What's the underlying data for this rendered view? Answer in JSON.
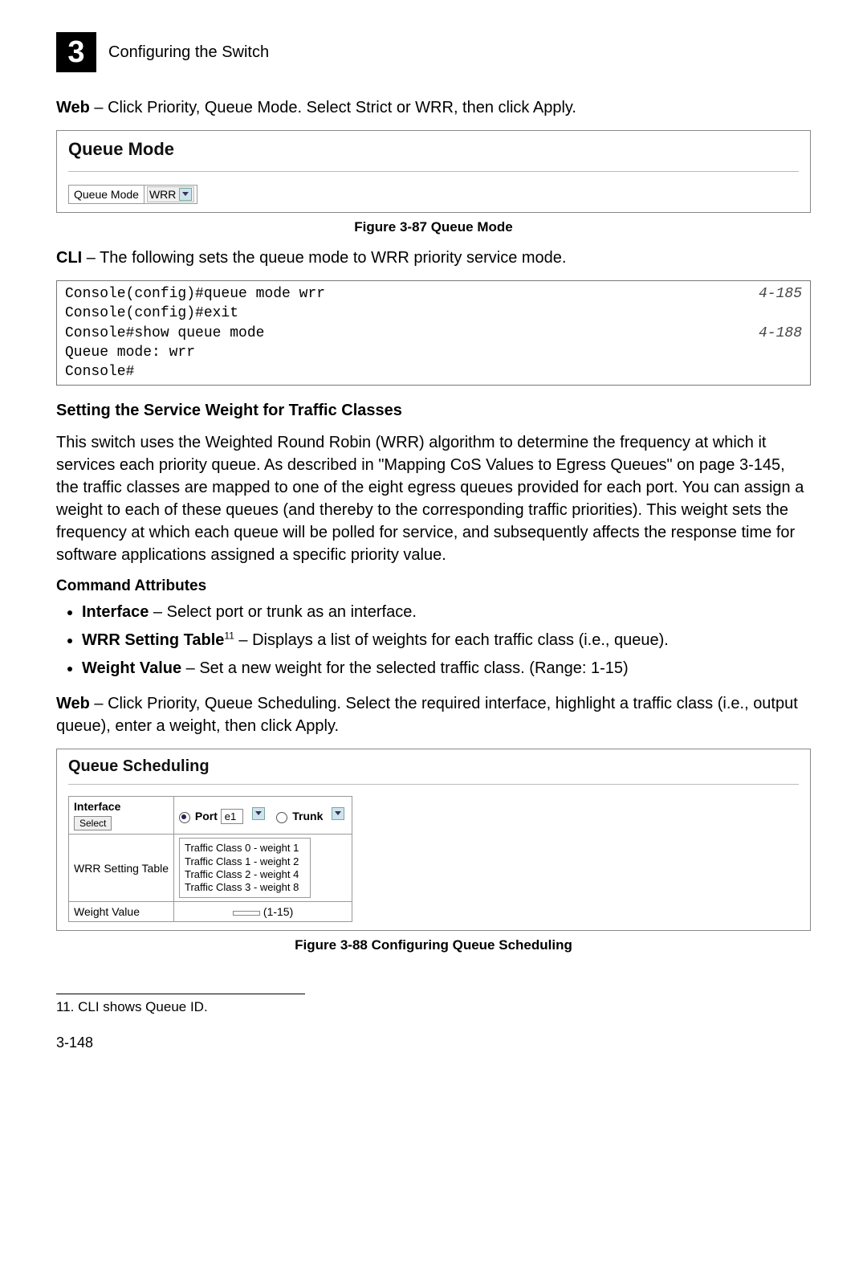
{
  "header": {
    "chapter_number": "3",
    "chapter_title": "Configuring the Switch"
  },
  "intro_web": {
    "bold": "Web",
    "rest": " – Click Priority, Queue Mode. Select Strict or WRR, then click Apply."
  },
  "fig87": {
    "panel_title": "Queue Mode",
    "row_label": "Queue Mode",
    "select_value": "WRR",
    "caption": "Figure 3-87  Queue Mode"
  },
  "cli_line": {
    "bold": "CLI",
    "rest": " – The following sets the queue mode to WRR priority service mode."
  },
  "code": {
    "lines": [
      {
        "text": "Console(config)#queue mode wrr",
        "ref": "4-185"
      },
      {
        "text": "Console(config)#exit",
        "ref": ""
      },
      {
        "text": "Console#show queue mode",
        "ref": "4-188"
      },
      {
        "text": "Queue mode: wrr",
        "ref": ""
      },
      {
        "text": "Console#",
        "ref": ""
      }
    ]
  },
  "section2": {
    "heading": "Setting the Service Weight for Traffic Classes",
    "para": "This switch uses the Weighted Round Robin (WRR) algorithm to determine the frequency at which it services each priority queue. As described in \"Mapping CoS Values to Egress Queues\" on page 3-145, the traffic classes are mapped to one of the eight egress queues provided for each port. You can assign a weight to each of these queues (and thereby to the corresponding traffic priorities). This weight sets the frequency at which each queue will be polled for service, and subsequently affects the response time for software applications assigned a specific priority value."
  },
  "cmd_attr": {
    "heading": "Command Attributes",
    "items": [
      {
        "bold": "Interface",
        "rest": " – Select port or trunk as an interface."
      },
      {
        "bold": "WRR Setting Table",
        "sup": "11",
        "rest": " – Displays a list of weights for each traffic class (i.e., queue)."
      },
      {
        "bold": "Weight Value",
        "rest": " – Set a new weight for the selected traffic class. (Range: 1-15)"
      }
    ]
  },
  "web2": {
    "bold": "Web",
    "rest": " – Click Priority, Queue Scheduling. Select the required interface, highlight a traffic class (i.e., output queue), enter a weight, then click Apply."
  },
  "fig88": {
    "panel_title": "Queue Scheduling",
    "iface_label": "Interface",
    "select_btn": "Select",
    "port_label": "Port",
    "port_value": "e1",
    "trunk_label": "Trunk",
    "wrr_label": "WRR Setting Table",
    "wrr_rows": [
      "Traffic Class 0 - weight 1",
      "Traffic Class 1 - weight 2",
      "Traffic Class 2 - weight 4",
      "Traffic Class 3 - weight 8"
    ],
    "weight_label": "Weight Value",
    "weight_hint": "(1-15)",
    "caption": "Figure 3-88  Configuring Queue Scheduling"
  },
  "footnote": "11. CLI shows Queue ID.",
  "page_number": "3-148"
}
